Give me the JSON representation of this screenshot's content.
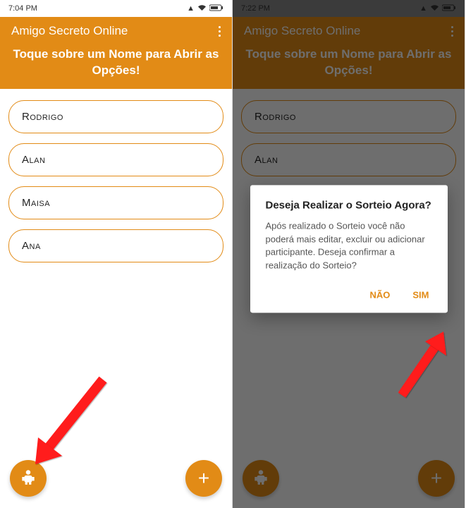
{
  "left": {
    "statusbar": {
      "time": "7:04 PM"
    },
    "header": {
      "title": "Amigo Secreto Online",
      "subtitle": "Toque sobre um Nome para Abrir as Opções!"
    },
    "names": [
      "Rodrigo",
      "Alan",
      "Maisa",
      "Ana"
    ]
  },
  "right": {
    "statusbar": {
      "time": "7:22 PM"
    },
    "header": {
      "title": "Amigo Secreto Online",
      "subtitle": "Toque sobre um Nome para Abrir as Opções!"
    },
    "names": [
      "Rodrigo",
      "Alan"
    ],
    "dialog": {
      "title": "Deseja Realizar o Sorteio Agora?",
      "body": "Após realizado o Sorteio você não poderá mais editar, excluir ou adicionar participante. Deseja confirmar a realização do Sorteio?",
      "no": "NÃO",
      "yes": "SIM"
    }
  },
  "colors": {
    "accent": "#e28b16",
    "arrow": "#ff1a1a"
  }
}
